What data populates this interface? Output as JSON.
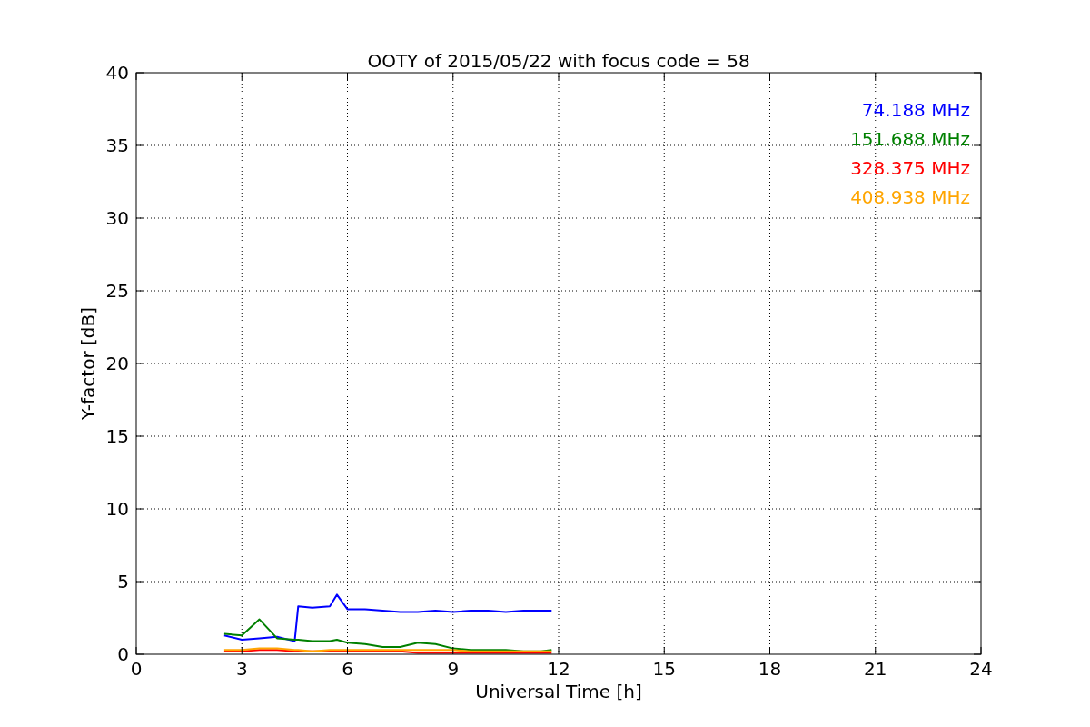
{
  "figure": {
    "chart_data": {
      "type": "line",
      "title": "OOTY of 2015/05/22 with focus code = 58",
      "xlabel": "Universal Time [h]",
      "ylabel": "Y-factor [dB]",
      "x": [
        2.5,
        3,
        3.5,
        4,
        4.5,
        4.6,
        5,
        5.5,
        5.7,
        6,
        6.5,
        7,
        7.5,
        8,
        8.5,
        9,
        9.5,
        10,
        10.5,
        11,
        11.5,
        11.8
      ],
      "series": [
        {
          "name": "74.188 MHz",
          "color": "#0000ff",
          "values": [
            1.3,
            1.0,
            1.1,
            1.2,
            0.9,
            3.3,
            3.2,
            3.3,
            4.1,
            3.1,
            3.1,
            3.0,
            2.9,
            2.9,
            3.0,
            2.9,
            3.0,
            3.0,
            2.9,
            3.0,
            3.0,
            3.0
          ]
        },
        {
          "name": "151.688 MHz",
          "color": "#008000",
          "values": [
            1.4,
            1.3,
            2.4,
            1.1,
            1.0,
            1.0,
            0.9,
            0.9,
            1.0,
            0.8,
            0.7,
            0.5,
            0.5,
            0.8,
            0.7,
            0.4,
            0.3,
            0.3,
            0.3,
            0.2,
            0.2,
            0.3
          ]
        },
        {
          "name": "328.375 MHz",
          "color": "#ff0000",
          "values": [
            0.2,
            0.2,
            0.3,
            0.3,
            0.2,
            0.2,
            0.2,
            0.2,
            0.2,
            0.2,
            0.2,
            0.2,
            0.2,
            0.1,
            0.1,
            0.1,
            0.1,
            0.1,
            0.1,
            0.1,
            0.1,
            0.1
          ]
        },
        {
          "name": "408.938 MHz",
          "color": "#ffa500",
          "values": [
            0.3,
            0.3,
            0.4,
            0.4,
            0.3,
            0.3,
            0.2,
            0.3,
            0.3,
            0.3,
            0.3,
            0.3,
            0.3,
            0.3,
            0.3,
            0.3,
            0.2,
            0.2,
            0.2,
            0.2,
            0.2,
            0.2
          ]
        }
      ],
      "xlim": [
        0,
        24
      ],
      "ylim": [
        0,
        40
      ],
      "xticks": [
        0,
        3,
        6,
        9,
        12,
        15,
        18,
        21,
        24
      ],
      "yticks": [
        0,
        5,
        10,
        15,
        20,
        25,
        30,
        35,
        40
      ],
      "grid": true
    }
  }
}
